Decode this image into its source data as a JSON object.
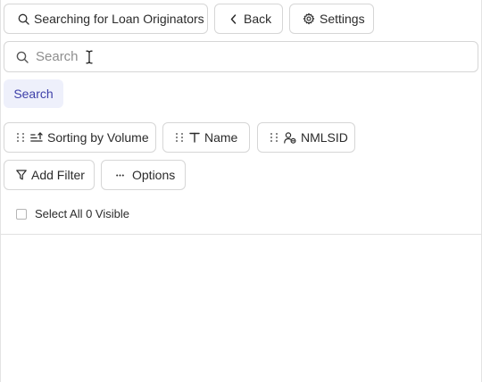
{
  "toolbar": {
    "searching_label": "Searching for Loan Originators",
    "back_label": "Back",
    "settings_label": "Settings"
  },
  "search": {
    "placeholder": "Search",
    "value": "",
    "submit_label": "Search"
  },
  "chips": [
    {
      "label": "Sorting by Volume",
      "icon": "sort-ascending-icon"
    },
    {
      "label": "Name",
      "icon": "text-type-icon"
    },
    {
      "label": "NMLSID",
      "icon": "user-id-icon"
    }
  ],
  "actions": {
    "add_filter_label": "Add Filter",
    "options_label": "Options"
  },
  "selection": {
    "select_all_label": "Select All 0 Visible",
    "checked": false
  },
  "colors": {
    "border": "#d6d6d6",
    "search_button_bg": "#eef0fb",
    "search_button_text": "#3d3fa8",
    "text": "#2b2b2b",
    "placeholder": "#8e8e8e"
  }
}
